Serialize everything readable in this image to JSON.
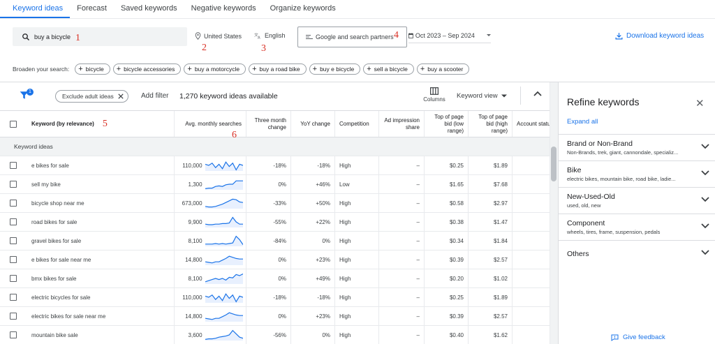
{
  "tabs": [
    "Keyword ideas",
    "Forecast",
    "Saved keywords",
    "Negative keywords",
    "Organize keywords"
  ],
  "search": {
    "value": "buy a bicycle"
  },
  "location": "United States",
  "language": "English",
  "network": "Google and search partners",
  "date_range": "Oct 2023 – Sep 2024",
  "download_label": "Download keyword ideas",
  "markers": [
    "1",
    "2",
    "3",
    "4",
    "5",
    "6"
  ],
  "broaden": {
    "label": "Broaden your search:",
    "chips": [
      "bicycle",
      "bicycle accessories",
      "buy a motorcycle",
      "buy a road bike",
      "buy e bicycle",
      "sell a bicycle",
      "buy a scooter"
    ]
  },
  "toolbar": {
    "filter_badge": "1",
    "exclude_chip": "Exclude adult ideas",
    "add_filter": "Add filter",
    "ideas_count": "1,270 keyword ideas available",
    "columns_label": "Columns",
    "keyword_view": "Keyword view"
  },
  "table": {
    "headers": {
      "keyword": "Keyword (by relevance)",
      "avg": "Avg. monthly searches",
      "three": "Three month change",
      "yoy": "YoY change",
      "comp": "Competition",
      "imp": "Ad impression share",
      "low": "Top of page bid (low range)",
      "high": "Top of page bid (high range)",
      "acct": "Account statu"
    },
    "group_label": "Keyword ideas",
    "rows": [
      {
        "kw": "e bikes for sale",
        "avg": "110,000",
        "three": "-18%",
        "yoy": "-18%",
        "comp": "High",
        "imp": "–",
        "low": "$0.25",
        "high": "$1.89",
        "trend": [
          0.6,
          0.5,
          0.7,
          0.3,
          0.6,
          0.2,
          0.8,
          0.4,
          0.7,
          0.1,
          0.6,
          0.5
        ]
      },
      {
        "kw": "sell my bike",
        "avg": "1,300",
        "three": "0%",
        "yoy": "+46%",
        "comp": "Low",
        "imp": "–",
        "low": "$1.65",
        "high": "$7.68",
        "trend": [
          0.1,
          0.15,
          0.15,
          0.3,
          0.35,
          0.3,
          0.45,
          0.5,
          0.5,
          0.8,
          0.8,
          0.8
        ]
      },
      {
        "kw": "bicycle shop near me",
        "avg": "673,000",
        "three": "-33%",
        "yoy": "+50%",
        "comp": "High",
        "imp": "–",
        "low": "$0.58",
        "high": "$2.97",
        "trend": [
          0.2,
          0.15,
          0.15,
          0.2,
          0.3,
          0.4,
          0.55,
          0.7,
          0.85,
          0.8,
          0.6,
          0.55
        ]
      },
      {
        "kw": "road bikes for sale",
        "avg": "9,900",
        "three": "-55%",
        "yoy": "+22%",
        "comp": "High",
        "imp": "–",
        "low": "$0.38",
        "high": "$1.47",
        "trend": [
          0.3,
          0.25,
          0.25,
          0.3,
          0.3,
          0.35,
          0.35,
          0.4,
          0.9,
          0.5,
          0.3,
          0.3
        ]
      },
      {
        "kw": "gravel bikes for sale",
        "avg": "8,100",
        "three": "-84%",
        "yoy": "0%",
        "comp": "High",
        "imp": "–",
        "low": "$0.34",
        "high": "$1.84",
        "trend": [
          0.2,
          0.2,
          0.2,
          0.25,
          0.2,
          0.25,
          0.2,
          0.25,
          0.3,
          0.9,
          0.6,
          0.15
        ]
      },
      {
        "kw": "e bikes for sale near me",
        "avg": "14,800",
        "three": "0%",
        "yoy": "+23%",
        "comp": "High",
        "imp": "–",
        "low": "$0.39",
        "high": "$2.57",
        "trend": [
          0.3,
          0.25,
          0.2,
          0.3,
          0.3,
          0.45,
          0.6,
          0.8,
          0.7,
          0.6,
          0.55,
          0.55
        ]
      },
      {
        "kw": "bmx bikes for sale",
        "avg": "8,100",
        "three": "0%",
        "yoy": "+49%",
        "comp": "High",
        "imp": "–",
        "low": "$0.20",
        "high": "$1.02",
        "trend": [
          0.2,
          0.3,
          0.4,
          0.5,
          0.4,
          0.5,
          0.35,
          0.6,
          0.55,
          0.85,
          0.75,
          0.9
        ]
      },
      {
        "kw": "electric bicycles for sale",
        "avg": "110,000",
        "three": "-18%",
        "yoy": "-18%",
        "comp": "High",
        "imp": "–",
        "low": "$0.25",
        "high": "$1.89",
        "trend": [
          0.6,
          0.5,
          0.7,
          0.3,
          0.6,
          0.2,
          0.8,
          0.4,
          0.7,
          0.1,
          0.6,
          0.5
        ]
      },
      {
        "kw": "electric bikes for sale near me",
        "avg": "14,800",
        "three": "0%",
        "yoy": "+23%",
        "comp": "High",
        "imp": "–",
        "low": "$0.39",
        "high": "$2.57",
        "trend": [
          0.3,
          0.25,
          0.2,
          0.3,
          0.3,
          0.45,
          0.6,
          0.8,
          0.7,
          0.6,
          0.55,
          0.55
        ]
      },
      {
        "kw": "mountain bike sale",
        "avg": "3,600",
        "three": "-56%",
        "yoy": "0%",
        "comp": "High",
        "imp": "–",
        "low": "$0.40",
        "high": "$1.62",
        "trend": [
          0.1,
          0.15,
          0.15,
          0.2,
          0.3,
          0.35,
          0.4,
          0.5,
          0.9,
          0.6,
          0.3,
          0.2
        ]
      }
    ]
  },
  "refine": {
    "title": "Refine keywords",
    "expand_all": "Expand all",
    "items": [
      {
        "name": "Brand or Non-Brand",
        "sub": "Non-Brands, trek, giant, cannondale, specializ..."
      },
      {
        "name": "Bike",
        "sub": "electric bikes, mountain bike, road bike, ladie..."
      },
      {
        "name": "New-Used-Old",
        "sub": "used, old, new"
      },
      {
        "name": "Component",
        "sub": "wheels, tires, frame, suspension, pedals"
      },
      {
        "name": "Others",
        "sub": ""
      }
    ],
    "feedback": "Give feedback"
  },
  "colors": {
    "accent": "#1a73e8",
    "marker": "#d93025"
  }
}
